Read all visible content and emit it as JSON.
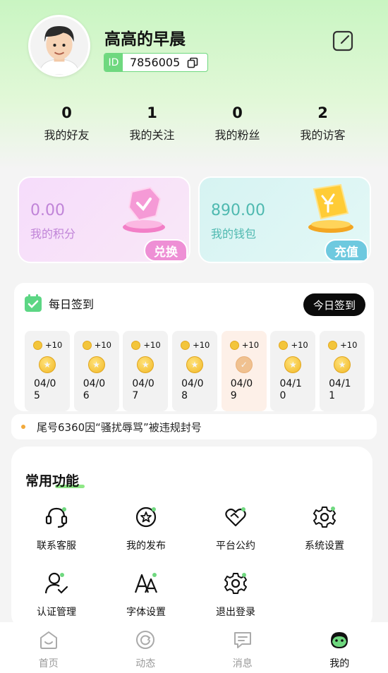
{
  "profile": {
    "nickname": "高高的早晨",
    "id_tag": "ID",
    "id_value": "7856005"
  },
  "stats": [
    {
      "value": "0",
      "label": "我的好友"
    },
    {
      "value": "1",
      "label": "我的关注"
    },
    {
      "value": "0",
      "label": "我的粉丝"
    },
    {
      "value": "2",
      "label": "我的访客"
    }
  ],
  "points": {
    "value": "0.00",
    "label": "我的积分",
    "button": "兑换"
  },
  "wallet": {
    "value": "890.00",
    "label": "我的钱包",
    "button": "充值"
  },
  "signin": {
    "title": "每日签到",
    "button": "今日签到",
    "days": [
      {
        "reward": "+10",
        "date": "04/05",
        "done": false
      },
      {
        "reward": "+10",
        "date": "04/06",
        "done": false
      },
      {
        "reward": "+10",
        "date": "04/07",
        "done": false
      },
      {
        "reward": "+10",
        "date": "04/08",
        "done": false
      },
      {
        "reward": "+10",
        "date": "04/09",
        "done": true
      },
      {
        "reward": "+10",
        "date": "04/10",
        "done": false
      },
      {
        "reward": "+10",
        "date": "04/11",
        "done": false
      }
    ]
  },
  "notice": {
    "text": "尾号6360因“骚扰辱骂”被违规封号"
  },
  "features": {
    "title": "常用功能",
    "items": [
      {
        "label": "联系客服",
        "icon": "headset-icon"
      },
      {
        "label": "我的发布",
        "icon": "star-badge-icon"
      },
      {
        "label": "平台公约",
        "icon": "heart-handshake-icon"
      },
      {
        "label": "系统设置",
        "icon": "gear-icon"
      },
      {
        "label": "认证管理",
        "icon": "user-check-icon"
      },
      {
        "label": "字体设置",
        "icon": "font-icon"
      },
      {
        "label": "退出登录",
        "icon": "logout-gear-icon"
      }
    ]
  },
  "tabs": [
    {
      "label": "首页",
      "icon": "home-icon",
      "active": false
    },
    {
      "label": "动态",
      "icon": "refresh-circle-icon",
      "active": false
    },
    {
      "label": "消息",
      "icon": "message-icon",
      "active": false
    },
    {
      "label": "我的",
      "icon": "mascot-face-icon",
      "active": true
    }
  ],
  "colors": {
    "accent": "#6fd87f",
    "points_text": "#c084d8",
    "wallet_text": "#4fb9b0",
    "notice_dot": "#f2a93b"
  }
}
